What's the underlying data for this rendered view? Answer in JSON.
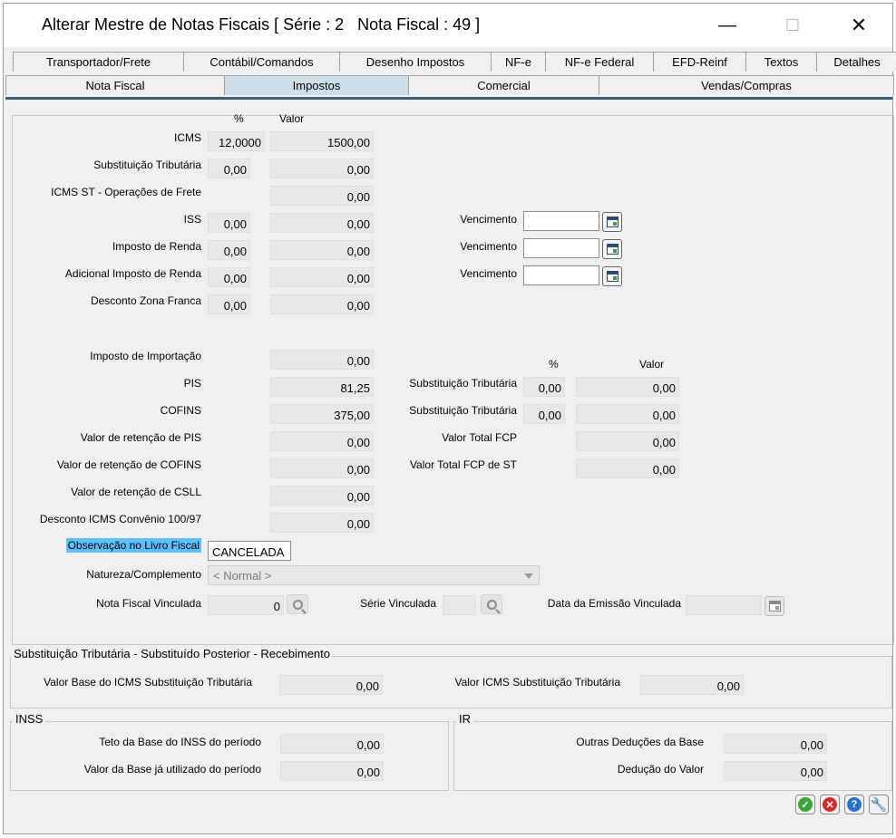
{
  "window": {
    "title": "Alterar Mestre de Notas Fiscais [ Série : 2   Nota Fiscal : 49 ]",
    "minimize": "—",
    "maximize": "☐",
    "close": "✕"
  },
  "tabs_row1": [
    "Transportador/Frete",
    "Contábil/Comandos",
    "Desenho Impostos",
    "NF-e",
    "NF-e Federal",
    "EFD-Reinf",
    "Textos",
    "Detalhes"
  ],
  "tabs_row2": [
    "Nota Fiscal",
    "Impostos",
    "Comercial",
    "Vendas/Compras"
  ],
  "active_tab": "Impostos",
  "impostos": {
    "col_pct": "%",
    "col_valor": "Valor",
    "icms_label": "ICMS",
    "icms_pct": "12,0000",
    "icms_valor": "1500,00",
    "subst_label": "Substituição Tributária",
    "subst_pct": "0,00",
    "subst_valor": "0,00",
    "icms_st_frete_label": "ICMS ST - Operações de Frete",
    "icms_st_frete_valor": "0,00",
    "iss_label": "ISS",
    "iss_pct": "0,00",
    "iss_valor": "0,00",
    "ir_label": "Imposto de Renda",
    "ir_pct": "0,00",
    "ir_valor": "0,00",
    "adic_ir_label": "Adicional Imposto de Renda",
    "adic_ir_pct": "0,00",
    "adic_ir_valor": "0,00",
    "zona_franca_label": "Desconto Zona Franca",
    "zona_franca_pct": "0,00",
    "zona_franca_valor": "0,00",
    "vencimento_label": "Vencimento",
    "importacao_label": "Imposto de Importação",
    "importacao_valor": "0,00",
    "pis_label": "PIS",
    "pis_valor": "81,25",
    "cofins_label": "COFINS",
    "cofins_valor": "375,00",
    "ret_pis_label": "Valor de retenção de PIS",
    "ret_pis_valor": "0,00",
    "ret_cofins_label": "Valor de retenção de COFINS",
    "ret_cofins_valor": "0,00",
    "ret_csll_label": "Valor de retenção de CSLL",
    "ret_csll_valor": "0,00",
    "desc_icms_label": "Desconto ICMS Convênio 100/97",
    "desc_icms_valor": "0,00",
    "obs_label": "Observação no Livro Fiscal",
    "obs_valor": "CANCELADA",
    "natureza_label": "Natureza/Complemento",
    "natureza_valor": "< Normal >",
    "nf_vinculada_label": "Nota Fiscal Vinculada",
    "nf_vinculada_valor": "0",
    "serie_vinculada_label": "Série Vinculada",
    "data_emissao_label": "Data da Emissão Vinculada",
    "r_col_pct": "%",
    "r_col_valor": "Valor",
    "r_subst1_label": "Substituição Tributária",
    "r_subst1_pct": "0,00",
    "r_subst1_valor": "0,00",
    "r_subst2_label": "Substituição Tributária",
    "r_subst2_pct": "0,00",
    "r_subst2_valor": "0,00",
    "fcp_label": "Valor Total FCP",
    "fcp_valor": "0,00",
    "fcp_st_label": "Valor Total FCP de ST",
    "fcp_st_valor": "0,00"
  },
  "st_group": {
    "title": "Substituição Tributária - Substituído Posterior - Recebimento",
    "base_label": "Valor Base do ICMS Substituição Tributária",
    "base_valor": "0,00",
    "icms_label": "Valor ICMS Substituição Tributária",
    "icms_valor": "0,00"
  },
  "inss_group": {
    "title": "INSS",
    "teto_label": "Teto da Base do INSS do período",
    "teto_valor": "0,00",
    "utilizado_label": "Valor da Base já utilizado do período",
    "utilizado_valor": "0,00"
  },
  "ir_group": {
    "title": "IR",
    "outras_label": "Outras Deduções da Base",
    "outras_valor": "0,00",
    "deducao_label": "Dedução do Valor",
    "deducao_valor": "0,00"
  },
  "actions": {
    "ok_icon": "check-icon",
    "cancel_icon": "cancel-icon",
    "help_icon": "help-icon",
    "tools_icon": "wrench-icon",
    "ok_color": "#3aa53a",
    "cancel_color": "#d22b2b",
    "help_color": "#2a72c8",
    "tools_color": "#e08a1a"
  }
}
